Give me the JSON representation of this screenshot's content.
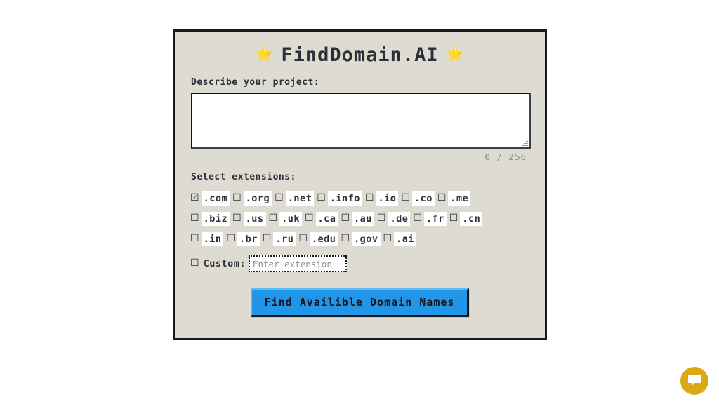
{
  "app": {
    "title": "FindDomain.AI",
    "star_left": "⭐",
    "star_right": "⭐"
  },
  "describe": {
    "label": "Describe your project:",
    "value": "",
    "placeholder": "",
    "counter": "0 / 256",
    "max_length": 256
  },
  "extensions": {
    "label": "Select extensions:",
    "checked_glyph": "☑",
    "unchecked_glyph": "☐",
    "rows": [
      [
        {
          "name": ".com",
          "checked": true
        },
        {
          "name": ".org",
          "checked": false
        },
        {
          "name": ".net",
          "checked": false
        },
        {
          "name": ".info",
          "checked": false
        },
        {
          "name": ".io",
          "checked": false
        },
        {
          "name": ".co",
          "checked": false
        },
        {
          "name": ".me",
          "checked": false
        }
      ],
      [
        {
          "name": ".biz",
          "checked": false
        },
        {
          "name": ".us",
          "checked": false
        },
        {
          "name": ".uk",
          "checked": false
        },
        {
          "name": ".ca",
          "checked": false
        },
        {
          "name": ".au",
          "checked": false
        },
        {
          "name": ".de",
          "checked": false
        },
        {
          "name": ".fr",
          "checked": false
        },
        {
          "name": ".cn",
          "checked": false
        }
      ],
      [
        {
          "name": ".in",
          "checked": false
        },
        {
          "name": ".br",
          "checked": false
        },
        {
          "name": ".ru",
          "checked": false
        },
        {
          "name": ".edu",
          "checked": false
        },
        {
          "name": ".gov",
          "checked": false
        },
        {
          "name": ".ai",
          "checked": false
        }
      ]
    ]
  },
  "custom": {
    "label": "Custom:",
    "checked": false,
    "input_value": "",
    "input_placeholder": "Enter extension"
  },
  "submit": {
    "label": "Find Availible Domain Names"
  },
  "chat_widget": {
    "icon": "chat-bubble-icon",
    "color": "#dba914"
  },
  "colors": {
    "page_background": "#ffffff",
    "panel_background": "#dedcd2",
    "panel_border": "#1a1a1a",
    "text": "#2b3038",
    "button_blue": "#2196e8",
    "counter_gray": "#8d8d85",
    "star_yellow": "#f5c518"
  }
}
